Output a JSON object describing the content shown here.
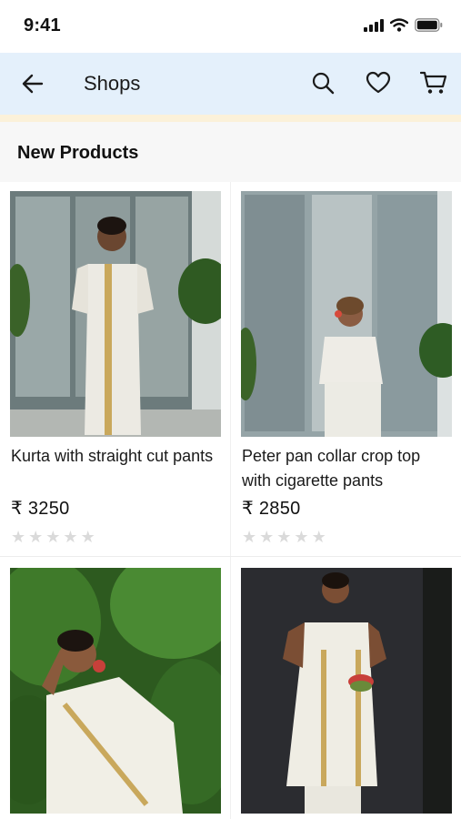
{
  "status_bar": {
    "time": "9:41"
  },
  "app_bar": {
    "title": "Shops"
  },
  "section": {
    "title": "New Products"
  },
  "products": [
    {
      "name": "Kurta with straight cut pants",
      "price": "₹ 3250",
      "rating": 0
    },
    {
      "name": "Peter pan collar crop top with cigarette pants",
      "price": "₹ 2850",
      "rating": 0
    },
    {
      "name": "",
      "price": "",
      "rating": null
    },
    {
      "name": "",
      "price": "",
      "rating": null
    }
  ],
  "rating_star_glyph": "★",
  "colors": {
    "app_bar_bg": "#e4f0fb",
    "accent_strip": "#fbf1d9",
    "section_bg": "#f7f7f7",
    "star_empty": "#dadada"
  },
  "icons": [
    "back-arrow-icon",
    "search-icon",
    "heart-icon",
    "cart-icon",
    "signal-icon",
    "wifi-icon",
    "battery-icon"
  ]
}
